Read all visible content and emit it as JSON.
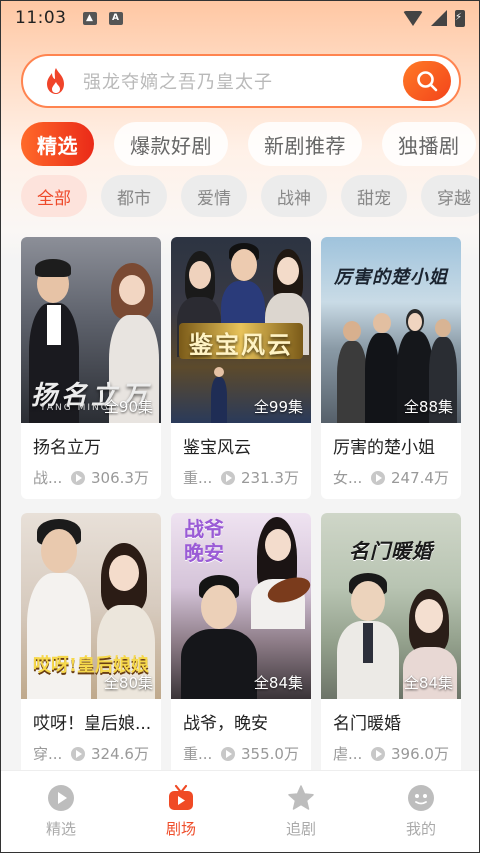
{
  "status_bar": {
    "time": "11:03"
  },
  "search": {
    "placeholder": "强龙夺嫡之吾乃皇太子",
    "accent": "#ff6a2a"
  },
  "top_tabs": [
    {
      "label": "精选",
      "active": true
    },
    {
      "label": "爆款好剧",
      "active": false
    },
    {
      "label": "新剧推荐",
      "active": false
    },
    {
      "label": "独播剧",
      "active": false
    }
  ],
  "sub_tabs": [
    {
      "label": "全部",
      "active": true
    },
    {
      "label": "都市",
      "active": false
    },
    {
      "label": "爱情",
      "active": false
    },
    {
      "label": "战神",
      "active": false
    },
    {
      "label": "甜宠",
      "active": false
    },
    {
      "label": "穿越",
      "active": false
    }
  ],
  "cards": [
    {
      "title": "扬名立万",
      "episodes": "全90集",
      "genre": "战...",
      "views": "306.3万",
      "poster_text": "扬名立万",
      "poster_sub": "YANG MING WAN"
    },
    {
      "title": "鉴宝风云",
      "episodes": "全99集",
      "genre": "重...",
      "views": "231.3万",
      "poster_text": "鉴宝风云"
    },
    {
      "title": "厉害的楚小姐",
      "episodes": "全88集",
      "genre": "女...",
      "views": "247.4万",
      "poster_text": "厉害的楚小姐"
    },
    {
      "title": "哎呀！皇后娘...",
      "episodes": "全80集",
      "genre": "穿...",
      "views": "324.6万",
      "poster_text": "哎呀!皇后娘娘"
    },
    {
      "title": "战爷，晚安",
      "episodes": "全84集",
      "genre": "重...",
      "views": "355.0万",
      "poster_text": "战爷 晚安"
    },
    {
      "title": "名门暖婚",
      "episodes": "全84集",
      "genre": "虐...",
      "views": "396.0万",
      "poster_text": "名门暖婚"
    }
  ],
  "bottom_nav": [
    {
      "label": "精选",
      "icon": "play-circle-icon",
      "active": false
    },
    {
      "label": "剧场",
      "icon": "tv-icon",
      "active": true
    },
    {
      "label": "追剧",
      "icon": "star-icon",
      "active": false
    },
    {
      "label": "我的",
      "icon": "smiley-icon",
      "active": false
    }
  ],
  "colors": {
    "accent": "#ef4d2a",
    "inactive": "#aaaaaa"
  }
}
